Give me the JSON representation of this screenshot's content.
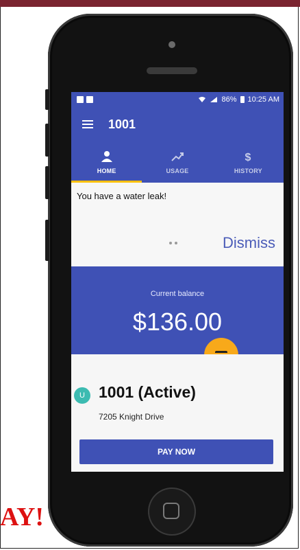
{
  "status_bar": {
    "time": "10:25 AM",
    "battery": "86%"
  },
  "app_bar": {
    "title": "1001"
  },
  "tabs": [
    {
      "label": "HOME",
      "icon": "person-icon",
      "active": true
    },
    {
      "label": "USAGE",
      "icon": "trend-icon",
      "active": false
    },
    {
      "label": "HISTORY",
      "icon": "dollar-icon",
      "active": false
    }
  ],
  "alert": {
    "message": "You have a water leak!",
    "dismiss_label": "Dismiss"
  },
  "balance": {
    "label": "Current balance",
    "amount": "$136.00"
  },
  "account": {
    "avatar_letter": "U",
    "title": "1001 (Active)",
    "address": "7205 Knight Drive"
  },
  "pay_button_label": "PAY NOW",
  "promo_text": "AY!",
  "colors": {
    "primary": "#3f51b5",
    "accent": "#ffc107",
    "fab": "#f8a91a",
    "avatar": "#3cbbb1"
  }
}
